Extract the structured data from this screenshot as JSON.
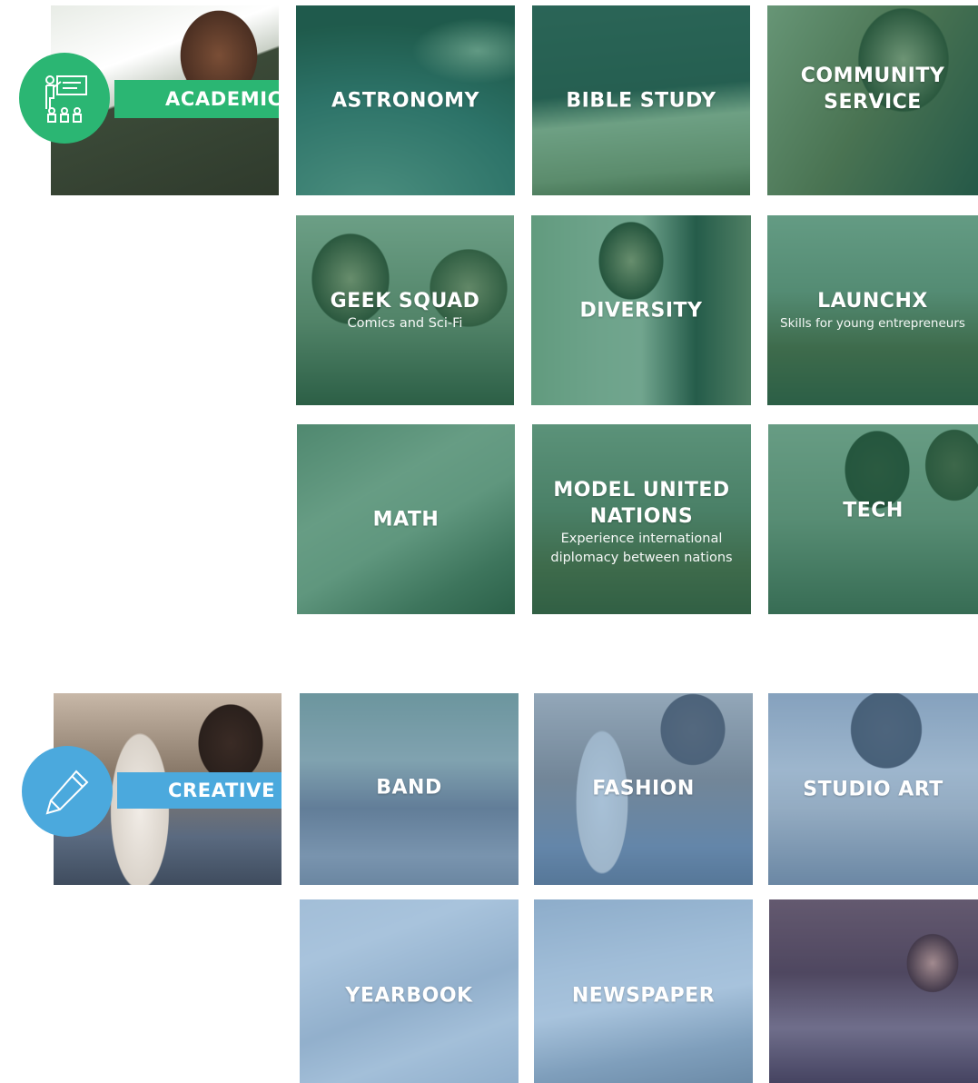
{
  "colors": {
    "academic_accent": "#2bb673",
    "creative_accent": "#4ba9dd",
    "tint_green": "#227650",
    "tint_blue": "#699bc8"
  },
  "academic": {
    "category_label": "ACADEMIC",
    "icon": "teacher-board-icon",
    "tiles": [
      {
        "title": "ASTRONOMY",
        "subtitle": ""
      },
      {
        "title": "BIBLE STUDY",
        "subtitle": ""
      },
      {
        "title": "COMMUNITY\nSERVICE",
        "subtitle": ""
      },
      {
        "title": "GEEK SQUAD",
        "subtitle": "Comics and Sci-Fi"
      },
      {
        "title": "DIVERSITY",
        "subtitle": ""
      },
      {
        "title": "LAUNCHX",
        "subtitle": "Skills for young entrepreneurs"
      },
      {
        "title": "MATH",
        "subtitle": ""
      },
      {
        "title": "MODEL UNITED\nNATIONS",
        "subtitle": "Experience international diplomacy between nations"
      },
      {
        "title": "TECH",
        "subtitle": ""
      }
    ]
  },
  "creative": {
    "category_label": "CREATIVE",
    "icon": "pencil-icon",
    "tiles": [
      {
        "title": "BAND",
        "subtitle": ""
      },
      {
        "title": "FASHION",
        "subtitle": ""
      },
      {
        "title": "STUDIO ART",
        "subtitle": ""
      },
      {
        "title": "YEARBOOK",
        "subtitle": ""
      },
      {
        "title": "NEWSPAPER",
        "subtitle": ""
      },
      {
        "title": "",
        "subtitle": ""
      }
    ]
  }
}
